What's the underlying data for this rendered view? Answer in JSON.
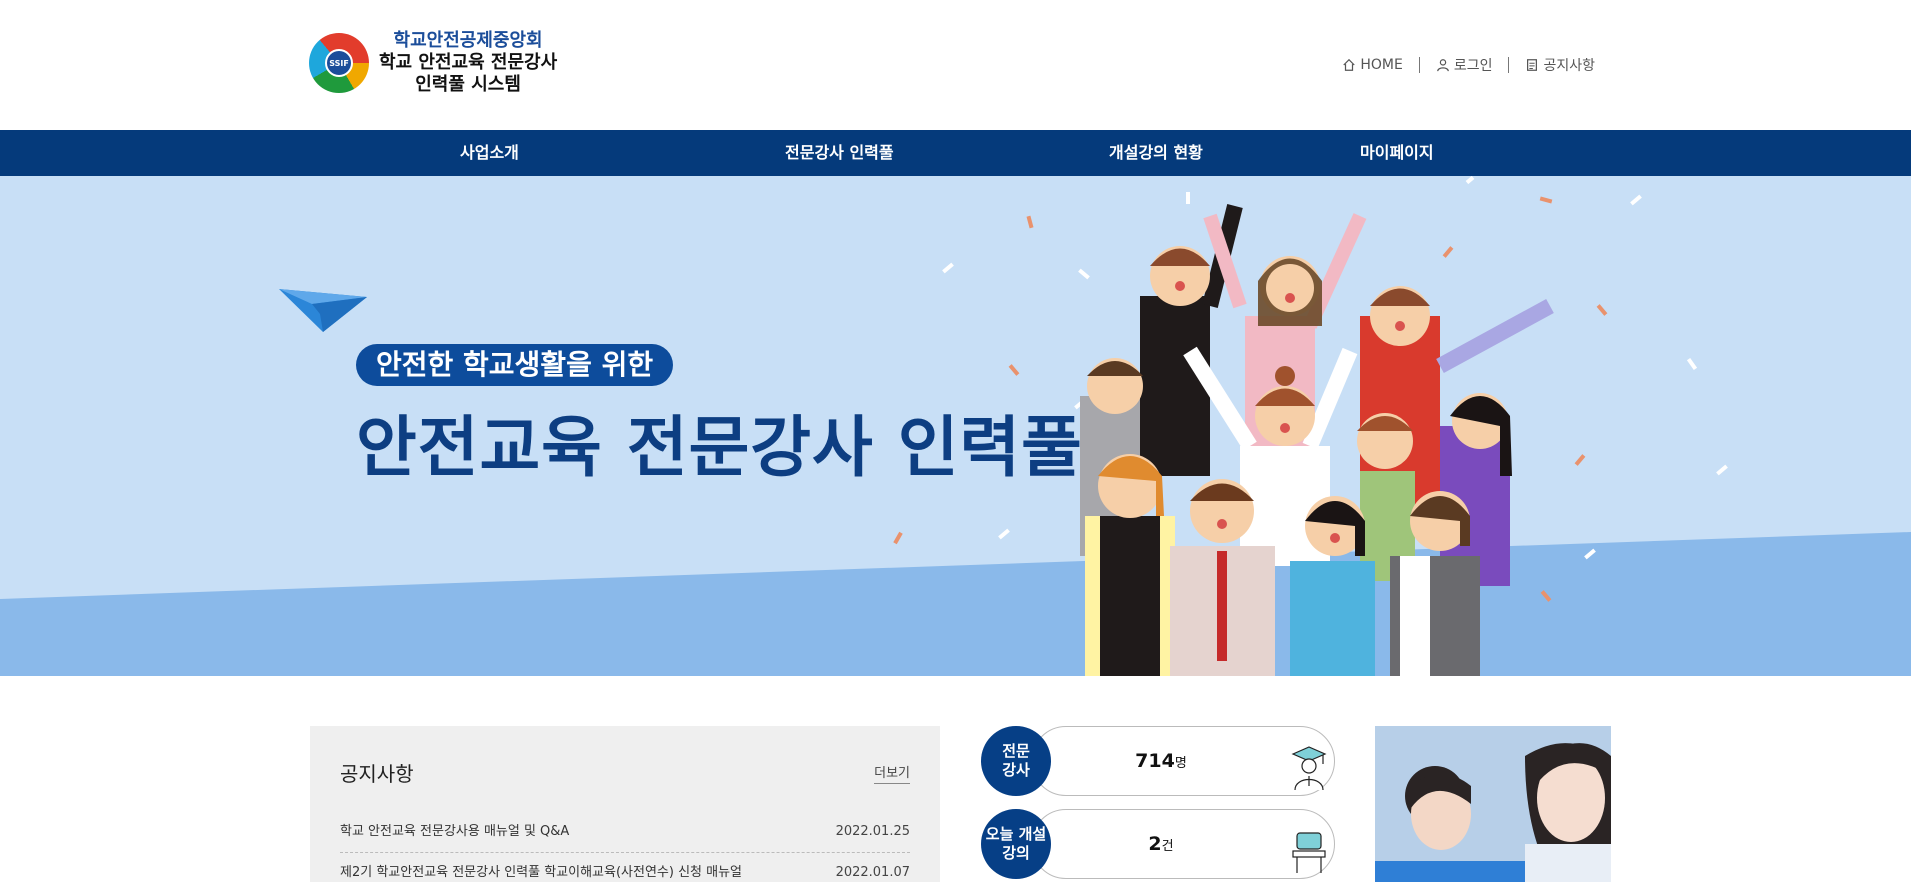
{
  "header": {
    "logo": {
      "emblem_text": "SSIF",
      "line1": "학교안전공제중앙회",
      "line2": "학교 안전교육 전문강사",
      "line3": "인력풀 시스템"
    },
    "util_links": [
      {
        "label": "HOME",
        "icon": "home-icon"
      },
      {
        "label": "로그인",
        "icon": "user-icon"
      },
      {
        "label": "공지사항",
        "icon": "document-icon"
      }
    ]
  },
  "nav": {
    "items": [
      {
        "label": "사업소개"
      },
      {
        "label": "전문강사 인력풀"
      },
      {
        "label": "개설강의 현황"
      },
      {
        "label": "마이페이지"
      }
    ]
  },
  "banner": {
    "subtitle": "안전한 학교생활을 위한",
    "title": "안전교육 전문강사 인력풀"
  },
  "notice": {
    "title": "공지사항",
    "more_label": "더보기",
    "items": [
      {
        "title": "학교 안전교육 전문강사용 매뉴얼 및 Q&A",
        "date": "2022.01.25"
      },
      {
        "title": "제2기 학교안전교육 전문강사 인력풀 학교이해교육(사전연수) 신청 매뉴얼",
        "date": "2022.01.07"
      }
    ]
  },
  "stats": [
    {
      "label_line1": "전문",
      "label_line2": "강사",
      "value": "714",
      "unit": "명",
      "icon": "graduate-icon"
    },
    {
      "label_line1": "오늘 개설",
      "label_line2": "강의",
      "value": "2",
      "unit": "건",
      "icon": "desk-icon"
    }
  ],
  "colors": {
    "nav_bg": "#053a7b",
    "banner_bg": "#c8dff6",
    "banner_band": "#8ab9ea",
    "headline": "#0d3e82",
    "pill": "#0d4c9c"
  }
}
